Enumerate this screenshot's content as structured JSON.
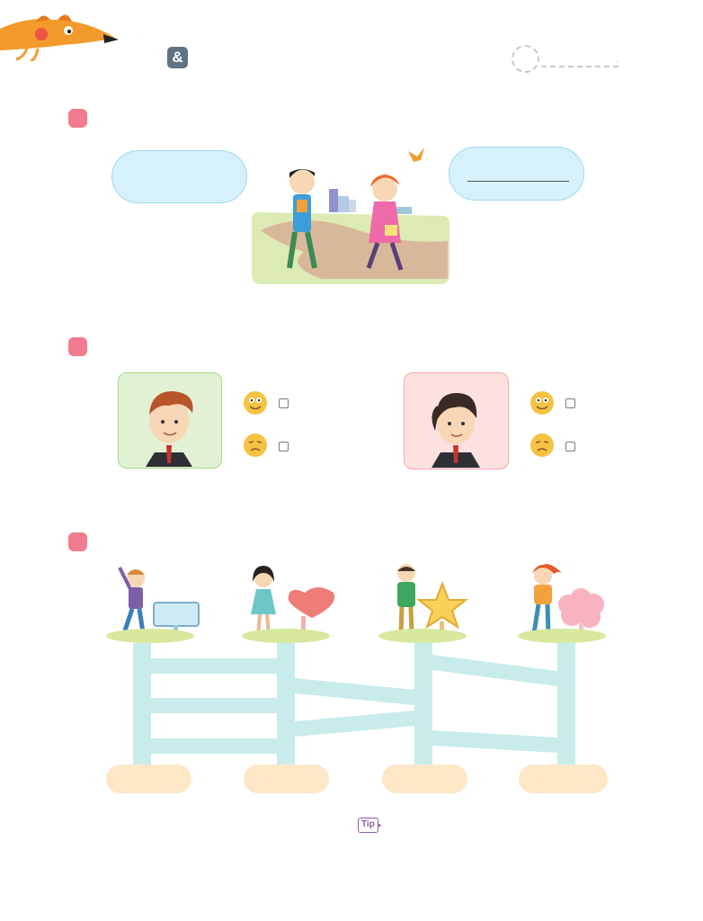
{
  "header": {
    "amp_badge": "&",
    "score_tail": "'"
  },
  "tip": {
    "label": "Tip"
  },
  "colors": {
    "marker": "#f17c8f",
    "bubble": "#d6f1fb",
    "track": "#c7ecea",
    "grass": "#d6e99c",
    "end_oval": "#fde7c7",
    "boy_card": "#e2f1d3",
    "girl_card": "#fde0e0",
    "tip": "#8a5ba8"
  }
}
